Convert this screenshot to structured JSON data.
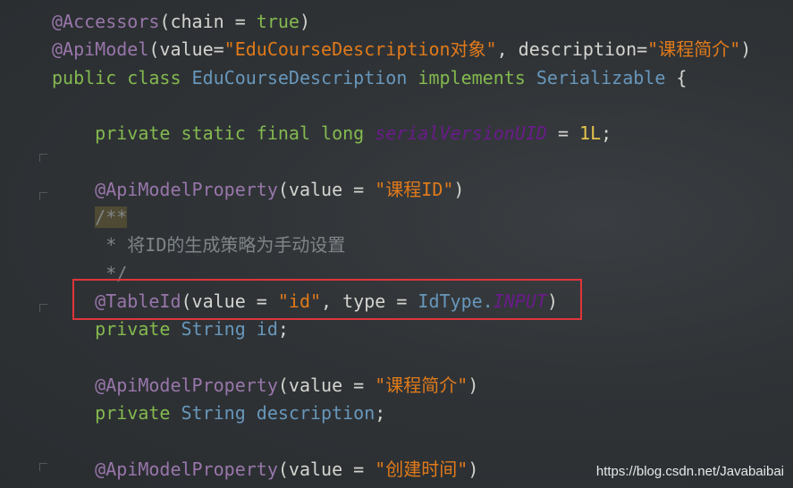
{
  "editor": {
    "colors": {
      "annotation": "#9876aa",
      "keyword": "#84b94f",
      "class": "#6897bb",
      "string": "#e07a1a",
      "comment": "#7f8487",
      "number": "#e8c34a",
      "static_field": "#6a1b8a",
      "highlight": "#e0353a"
    },
    "lines": [
      [
        [
          "ann",
          "@Accessors"
        ],
        [
          "plain",
          "(chain = "
        ],
        [
          "kw",
          "true"
        ],
        [
          "plain",
          ")"
        ]
      ],
      [
        [
          "ann",
          "@ApiModel"
        ],
        [
          "plain",
          "(value="
        ],
        [
          "str",
          "\"EduCourseDescription对象\""
        ],
        [
          "plain",
          ", description="
        ],
        [
          "str",
          "\"课程简介\""
        ],
        [
          "plain",
          ")"
        ]
      ],
      [
        [
          "kw",
          "public class "
        ],
        [
          "cls",
          "EduCourseDescription "
        ],
        [
          "kw",
          "implements "
        ],
        [
          "cls",
          "Serializable "
        ],
        [
          "plain",
          "{"
        ]
      ],
      [],
      [
        [
          "plain",
          "    "
        ],
        [
          "kw",
          "private static final long "
        ],
        [
          "sf",
          "serialVersionUID"
        ],
        [
          "plain",
          " = "
        ],
        [
          "num",
          "1L"
        ],
        [
          "plain",
          ";"
        ]
      ],
      [],
      [
        [
          "plain",
          "    "
        ],
        [
          "ann",
          "@ApiModelProperty"
        ],
        [
          "plain",
          "(value = "
        ],
        [
          "str",
          "\"课程ID\""
        ],
        [
          "plain",
          ")"
        ]
      ],
      [
        [
          "plain",
          "    "
        ],
        [
          "cmt doc-hl",
          "/**"
        ]
      ],
      [
        [
          "cmt",
          "     * 将ID的生成策略为手动设置"
        ]
      ],
      [
        [
          "cmt",
          "     */"
        ]
      ],
      [
        [
          "plain",
          "    "
        ],
        [
          "ann",
          "@TableId"
        ],
        [
          "plain",
          "(value = "
        ],
        [
          "str",
          "\"id\""
        ],
        [
          "plain",
          ", type = "
        ],
        [
          "cls",
          "IdType."
        ],
        [
          "sf",
          "INPUT"
        ],
        [
          "plain",
          ")"
        ]
      ],
      [
        [
          "plain",
          "    "
        ],
        [
          "kw",
          "private "
        ],
        [
          "cls",
          "String id"
        ],
        [
          "plain",
          ";"
        ]
      ],
      [],
      [
        [
          "plain",
          "    "
        ],
        [
          "ann",
          "@ApiModelProperty"
        ],
        [
          "plain",
          "(value = "
        ],
        [
          "str",
          "\"课程简介\""
        ],
        [
          "plain",
          ")"
        ]
      ],
      [
        [
          "plain",
          "    "
        ],
        [
          "kw",
          "private "
        ],
        [
          "cls",
          "String description"
        ],
        [
          "plain",
          ";"
        ]
      ],
      [],
      [
        [
          "plain",
          "    "
        ],
        [
          "ann",
          "@ApiModelProperty"
        ],
        [
          "plain",
          "(value = "
        ],
        [
          "str",
          "\"创建时间\""
        ],
        [
          "plain",
          ")"
        ]
      ]
    ]
  },
  "watermark": "https://blog.csdn.net/Javabaibai"
}
